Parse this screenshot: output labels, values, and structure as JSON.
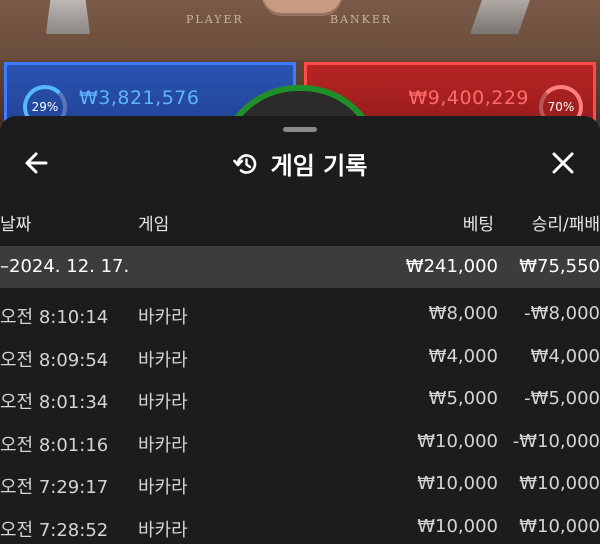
{
  "game_view": {
    "player_label": "PLAYER",
    "banker_label": "BANKER",
    "player_percent": "29%",
    "player_amount": "₩3,821,576",
    "banker_percent": "70%",
    "banker_amount": "₩9,400,229",
    "player_color": "#3e7bff",
    "banker_color": "#ff4a4a"
  },
  "sheet": {
    "title": "게임 기록",
    "title_icon": "history-icon",
    "back_icon": "arrow-left-icon",
    "close_icon": "close-icon",
    "columns": {
      "date": "날짜",
      "game": "게임",
      "bet": "베팅",
      "result": "승리/패배"
    },
    "date_group": {
      "date": "–2024. 12. 17.",
      "total_bet": "₩241,000",
      "total_result": "₩75,550"
    },
    "rows": [
      {
        "time": "오전 8:10:14",
        "game": "바카라",
        "bet": "₩8,000",
        "result": "-₩8,000"
      },
      {
        "time": "오전 8:09:54",
        "game": "바카라",
        "bet": "₩4,000",
        "result": "₩4,000"
      },
      {
        "time": "오전 8:01:34",
        "game": "바카라",
        "bet": "₩5,000",
        "result": "-₩5,000"
      },
      {
        "time": "오전 8:01:16",
        "game": "바카라",
        "bet": "₩10,000",
        "result": "-₩10,000"
      },
      {
        "time": "오전 7:29:17",
        "game": "바카라",
        "bet": "₩10,000",
        "result": "₩10,000"
      },
      {
        "time": "오전 7:28:52",
        "game": "바카라",
        "bet": "₩10,000",
        "result": "₩10,000"
      }
    ]
  }
}
